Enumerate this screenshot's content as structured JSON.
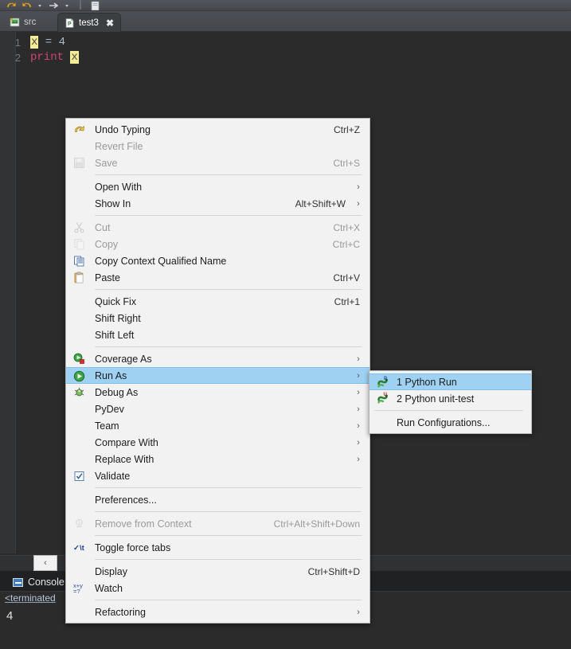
{
  "app": {
    "title": "Eclipse PyDev editor with context menu"
  },
  "tabs": [
    {
      "label": "src",
      "icon": "project-folder-icon",
      "active": false,
      "closable": false
    },
    {
      "label": "test3",
      "icon": "python-file-icon",
      "active": true,
      "closable": true,
      "close_glyph": "✖"
    }
  ],
  "editor": {
    "lines": [
      {
        "num": "1",
        "segments": [
          {
            "text": "x",
            "style": "highlight"
          },
          {
            "text": " = ",
            "style": "op"
          },
          {
            "text": "4",
            "style": "num"
          }
        ]
      },
      {
        "num": "2",
        "segments": [
          {
            "text": "print",
            "style": "kw"
          },
          {
            "text": " ",
            "style": "op"
          },
          {
            "text": "x",
            "style": "highlight"
          }
        ]
      }
    ],
    "scroll_left_glyph": "‹"
  },
  "console": {
    "tab_label": "Console",
    "terminated_text": "<terminated",
    "output": "4"
  },
  "context_menu": {
    "items": [
      {
        "type": "item",
        "label": "Undo Typing",
        "accel": "Ctrl+Z",
        "icon": "undo-icon",
        "disabled": false,
        "submenu": false
      },
      {
        "type": "item",
        "label": "Revert File",
        "accel": "",
        "icon": "",
        "disabled": true,
        "submenu": false
      },
      {
        "type": "item",
        "label": "Save",
        "accel": "Ctrl+S",
        "icon": "save-icon",
        "disabled": true,
        "submenu": false
      },
      {
        "type": "separator"
      },
      {
        "type": "item",
        "label": "Open With",
        "accel": "",
        "icon": "",
        "disabled": false,
        "submenu": true
      },
      {
        "type": "item",
        "label": "Show In",
        "accel": "Alt+Shift+W",
        "icon": "",
        "disabled": false,
        "submenu": true
      },
      {
        "type": "separator"
      },
      {
        "type": "item",
        "label": "Cut",
        "accel": "Ctrl+X",
        "icon": "cut-icon",
        "disabled": true,
        "submenu": false
      },
      {
        "type": "item",
        "label": "Copy",
        "accel": "Ctrl+C",
        "icon": "copy-icon",
        "disabled": true,
        "submenu": false
      },
      {
        "type": "item",
        "label": "Copy Context Qualified Name",
        "accel": "",
        "icon": "copy-qualified-icon",
        "disabled": false,
        "submenu": false
      },
      {
        "type": "item",
        "label": "Paste",
        "accel": "Ctrl+V",
        "icon": "paste-icon",
        "disabled": false,
        "submenu": false
      },
      {
        "type": "separator"
      },
      {
        "type": "item",
        "label": "Quick Fix",
        "accel": "Ctrl+1",
        "icon": "",
        "disabled": false,
        "submenu": false
      },
      {
        "type": "item",
        "label": "Shift Right",
        "accel": "",
        "icon": "",
        "disabled": false,
        "submenu": false
      },
      {
        "type": "item",
        "label": "Shift Left",
        "accel": "",
        "icon": "",
        "disabled": false,
        "submenu": false
      },
      {
        "type": "separator"
      },
      {
        "type": "item",
        "label": "Coverage As",
        "accel": "",
        "icon": "coverage-icon",
        "disabled": false,
        "submenu": true
      },
      {
        "type": "item",
        "label": "Run As",
        "accel": "",
        "icon": "run-icon",
        "disabled": false,
        "submenu": true,
        "selected": true
      },
      {
        "type": "item",
        "label": "Debug As",
        "accel": "",
        "icon": "debug-icon",
        "disabled": false,
        "submenu": true
      },
      {
        "type": "item",
        "label": "PyDev",
        "accel": "",
        "icon": "",
        "disabled": false,
        "submenu": true
      },
      {
        "type": "item",
        "label": "Team",
        "accel": "",
        "icon": "",
        "disabled": false,
        "submenu": true
      },
      {
        "type": "item",
        "label": "Compare With",
        "accel": "",
        "icon": "",
        "disabled": false,
        "submenu": true
      },
      {
        "type": "item",
        "label": "Replace With",
        "accel": "",
        "icon": "",
        "disabled": false,
        "submenu": true
      },
      {
        "type": "item",
        "label": "Validate",
        "accel": "",
        "icon": "validate-checkbox-icon",
        "disabled": false,
        "submenu": false
      },
      {
        "type": "separator"
      },
      {
        "type": "item",
        "label": "Preferences...",
        "accel": "",
        "icon": "",
        "disabled": false,
        "submenu": false
      },
      {
        "type": "separator"
      },
      {
        "type": "item",
        "label": "Remove from Context",
        "accel": "Ctrl+Alt+Shift+Down",
        "icon": "remove-context-icon",
        "disabled": true,
        "submenu": false
      },
      {
        "type": "separator"
      },
      {
        "type": "item",
        "label": "Toggle force tabs",
        "accel": "",
        "icon": "toggle-tabs-icon",
        "disabled": false,
        "submenu": false
      },
      {
        "type": "separator"
      },
      {
        "type": "item",
        "label": "Display",
        "accel": "Ctrl+Shift+D",
        "icon": "",
        "disabled": false,
        "submenu": false
      },
      {
        "type": "item",
        "label": "Watch",
        "accel": "",
        "icon": "watch-icon",
        "disabled": false,
        "submenu": false
      },
      {
        "type": "separator"
      },
      {
        "type": "item",
        "label": "Refactoring",
        "accel": "",
        "icon": "",
        "disabled": false,
        "submenu": true
      }
    ],
    "submenu_arrow_glyph": "›"
  },
  "submenu": {
    "title": "Run As",
    "items": [
      {
        "type": "item",
        "label": "1 Python Run",
        "icon": "python-run-icon",
        "selected": true
      },
      {
        "type": "item",
        "label": "2 Python unit-test",
        "icon": "python-unittest-icon",
        "selected": false
      },
      {
        "type": "separator"
      },
      {
        "type": "item",
        "label": "Run Configurations...",
        "icon": "",
        "selected": false
      }
    ]
  },
  "colors": {
    "menu_bg": "#f2f2f2",
    "menu_selection": "#9fd2f2",
    "editor_bg": "#2b2b2b",
    "keyword": "#cc4477",
    "highlight": "#f5ec9a"
  }
}
